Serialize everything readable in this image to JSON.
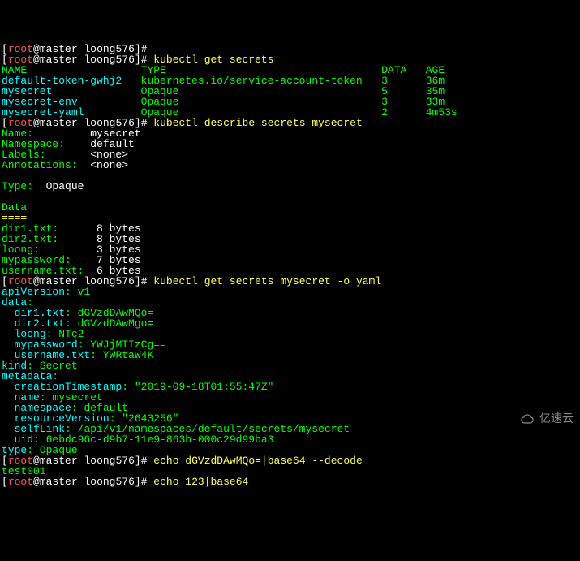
{
  "prompt": {
    "user": "root",
    "host": "master",
    "path": "loong576",
    "separator": "@"
  },
  "commands": {
    "cmd0_partial": "",
    "cmd1": "kubectl get secrets",
    "cmd2": "kubectl describe secrets mysecret",
    "cmd3": "kubectl get secrets mysecret -o yaml",
    "cmd4": "echo dGVzdDAwMQo=|base64 --decode",
    "cmd5_partial": "echo 123|base64"
  },
  "table": {
    "header": {
      "name": "NAME",
      "type": "TYPE",
      "data": "DATA",
      "age": "AGE"
    },
    "rows": [
      {
        "name": "default-token-gwhj2",
        "type": "kubernetes.io/service-account-token",
        "data": "3",
        "age": "36m"
      },
      {
        "name": "mysecret",
        "type": "Opaque",
        "data": "5",
        "age": "35m"
      },
      {
        "name": "mysecret-env",
        "type": "Opaque",
        "data": "3",
        "age": "33m"
      },
      {
        "name": "mysecret-yaml",
        "type": "Opaque",
        "data": "2",
        "age": "4m53s"
      }
    ]
  },
  "describe": {
    "name_label": "Name:",
    "name": "mysecret",
    "namespace_label": "Namespace:",
    "namespace": "default",
    "labels_label": "Labels:",
    "labels": "<none>",
    "annotations_label": "Annotations:",
    "annotations": "<none>",
    "type_label": "Type:",
    "type": "Opaque",
    "data_header": "Data",
    "data_sep": "====",
    "data_items": {
      "dir1": {
        "key": "dir1.txt:",
        "val": "8 bytes"
      },
      "dir2": {
        "key": "dir2.txt:",
        "val": "8 bytes"
      },
      "loong": {
        "key": "loong:",
        "val": "3 bytes"
      },
      "mypassword": {
        "key": "mypassword:",
        "val": "7 bytes"
      },
      "username": {
        "key": "username.txt:",
        "val": "6 bytes"
      }
    }
  },
  "yaml": {
    "apiVersion_k": "apiVersion",
    "apiVersion_v": "v1",
    "data_k": "data",
    "dir1_k": "dir1.txt",
    "dir1_v": "dGVzdDAwMQo=",
    "dir2_k": "dir2.txt",
    "dir2_v": "dGVzdDAwMgo=",
    "loong_k": "loong",
    "loong_v": "NTc2",
    "mypassword_k": "mypassword",
    "mypassword_v": "YWJjMTIzCg==",
    "username_k": "username.txt",
    "username_v": "YWRtaW4K",
    "kind_k": "kind",
    "kind_v": "Secret",
    "metadata_k": "metadata",
    "creationTimestamp_k": "creationTimestamp",
    "creationTimestamp_v": "\"2019-09-18T01:55:47Z\"",
    "name_k": "name",
    "name_v": "mysecret",
    "namespace_k": "namespace",
    "namespace_v": "default",
    "resourceVersion_k": "resourceVersion",
    "resourceVersion_v": "\"2643256\"",
    "selfLink_k": "selfLink",
    "selfLink_v": "/api/v1/namespaces/default/secrets/mysecret",
    "uid_k": "uid",
    "uid_v": "6ebdc96c-d9b7-11e9-863b-000c29d99ba3",
    "type_k": "type",
    "type_v": "Opaque"
  },
  "decode_output": "test001",
  "watermark": "亿速云"
}
